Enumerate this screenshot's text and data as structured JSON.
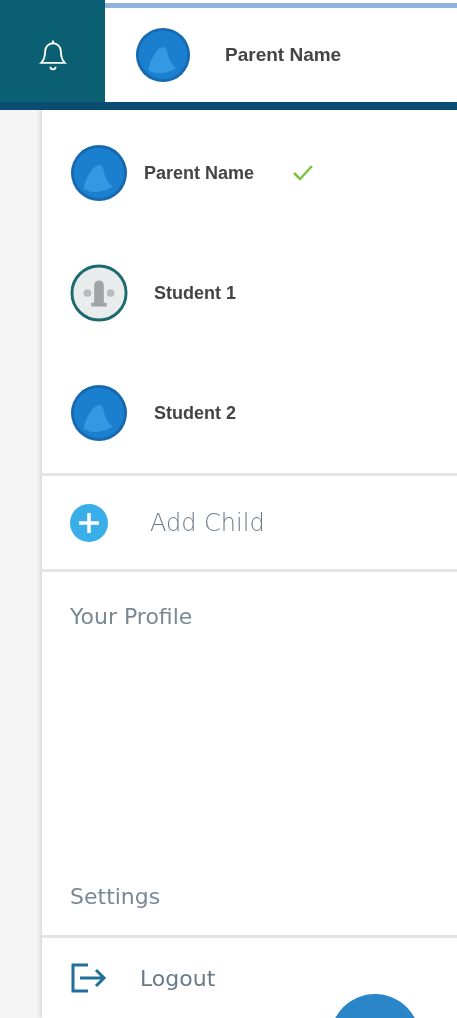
{
  "header": {
    "user_name": "Parent Name"
  },
  "accounts": [
    {
      "name": "Parent Name",
      "kind": "blue",
      "selected": true
    },
    {
      "name": "Student 1",
      "kind": "seal",
      "selected": false
    },
    {
      "name": "Student 2",
      "kind": "blue",
      "selected": false
    }
  ],
  "add_child": "Add Child",
  "links": [
    "Your Profile",
    "Settings"
  ],
  "logout": "Logout"
}
